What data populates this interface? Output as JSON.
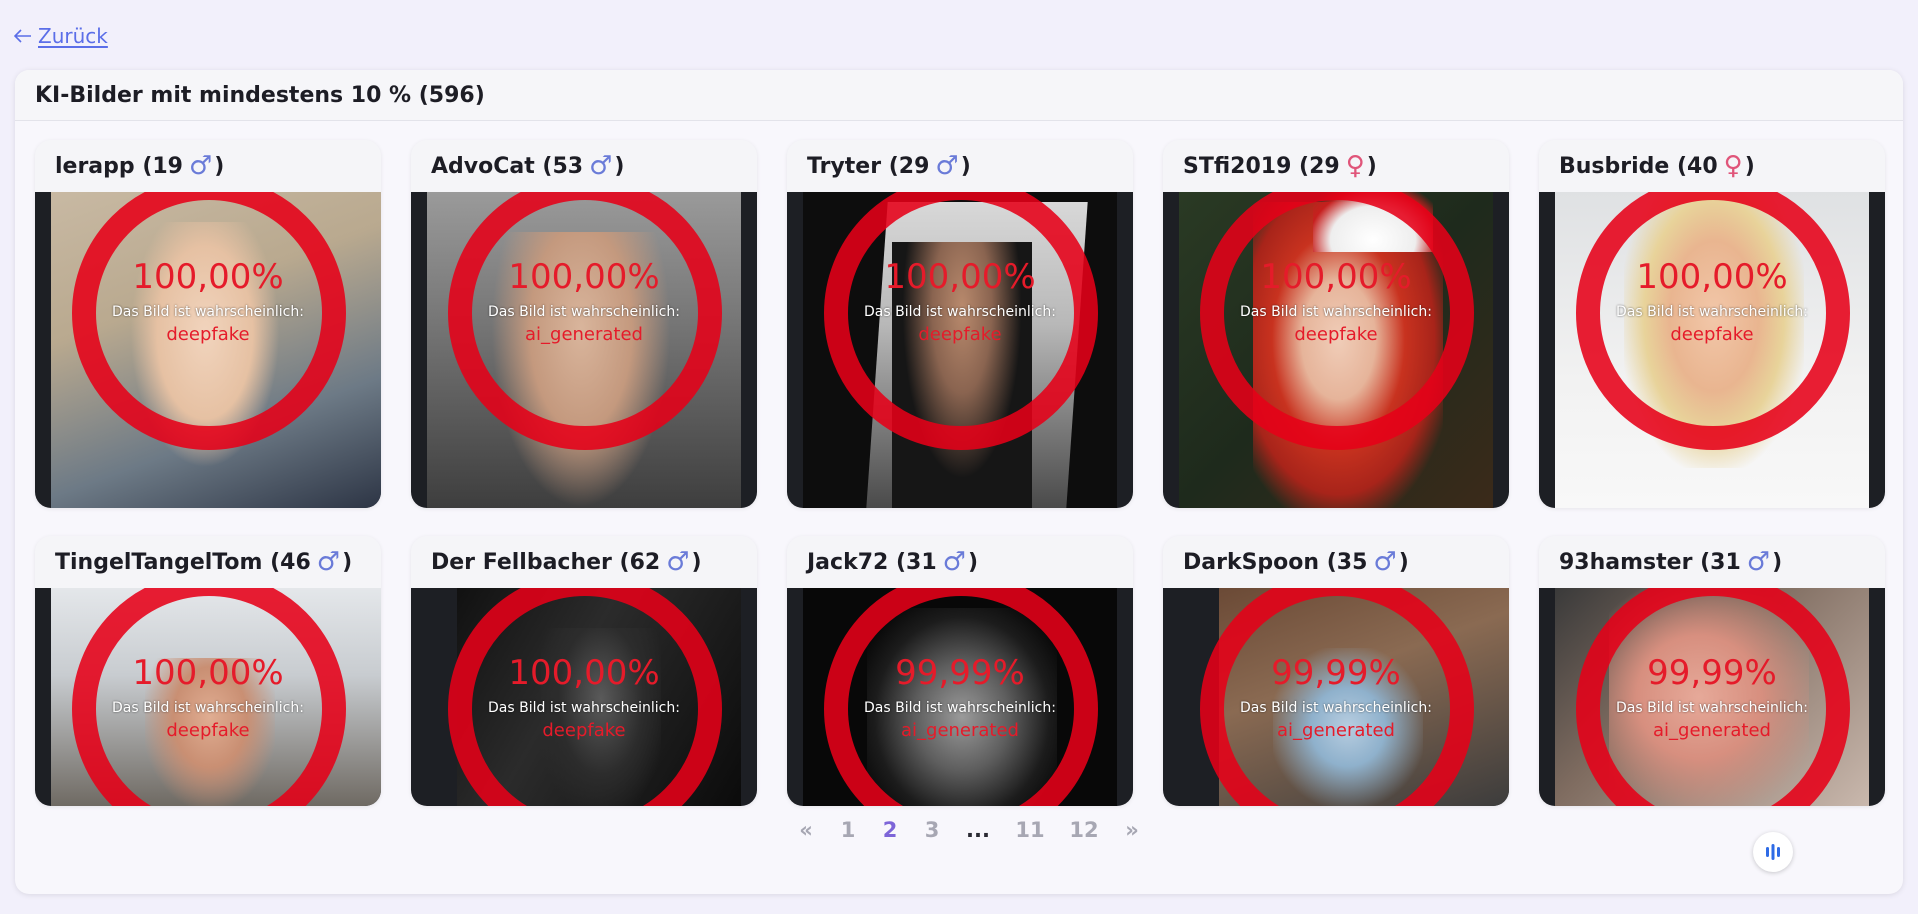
{
  "nav": {
    "back_label": "Zurück"
  },
  "panel": {
    "title": "KI-Bilder mit mindestens 10 % (596)"
  },
  "overlay_hint": "Das Bild ist wahrscheinlich:",
  "cards": [
    {
      "title": "lerapp (19",
      "gender": "male",
      "gender_symbol": "♂",
      "suffix": ")",
      "percent": "100,00%",
      "verdict": "deepfake"
    },
    {
      "title": "AdvoCat (53",
      "gender": "male",
      "gender_symbol": "♂",
      "suffix": ")",
      "percent": "100,00%",
      "verdict": "ai_generated"
    },
    {
      "title": "Tryter (29",
      "gender": "male",
      "gender_symbol": "♂",
      "suffix": ")",
      "percent": "100,00%",
      "verdict": "deepfake"
    },
    {
      "title": "STfi2019 (29",
      "gender": "female",
      "gender_symbol": "♀",
      "suffix": ")",
      "percent": "100,00%",
      "verdict": "deepfake"
    },
    {
      "title": "Busbride (40",
      "gender": "female",
      "gender_symbol": "♀",
      "suffix": ")",
      "percent": "100,00%",
      "verdict": "deepfake"
    },
    {
      "title": "TingelTangelTom (46",
      "gender": "male",
      "gender_symbol": "♂",
      "suffix": ")",
      "percent": "100,00%",
      "verdict": "deepfake"
    },
    {
      "title": "Der Fellbacher (62",
      "gender": "male",
      "gender_symbol": "♂",
      "suffix": ")",
      "percent": "100,00%",
      "verdict": "deepfake"
    },
    {
      "title": "Jack72 (31",
      "gender": "male",
      "gender_symbol": "♂",
      "suffix": ")",
      "percent": "99,99%",
      "verdict": "ai_generated"
    },
    {
      "title": "DarkSpoon (35",
      "gender": "male",
      "gender_symbol": "♂",
      "suffix": ")",
      "percent": "99,99%",
      "verdict": "ai_generated"
    },
    {
      "title": "93hamster (31",
      "gender": "male",
      "gender_symbol": "♂",
      "suffix": ")",
      "percent": "99,99%",
      "verdict": "ai_generated"
    }
  ],
  "pagination": {
    "prev": "«",
    "pages": [
      "1",
      "2",
      "3",
      "...",
      "11",
      "12"
    ],
    "current": "2",
    "next": "»"
  },
  "colors": {
    "accent": "#5b6ee8",
    "ring": "#e60018",
    "active_page": "#7d65d8"
  }
}
